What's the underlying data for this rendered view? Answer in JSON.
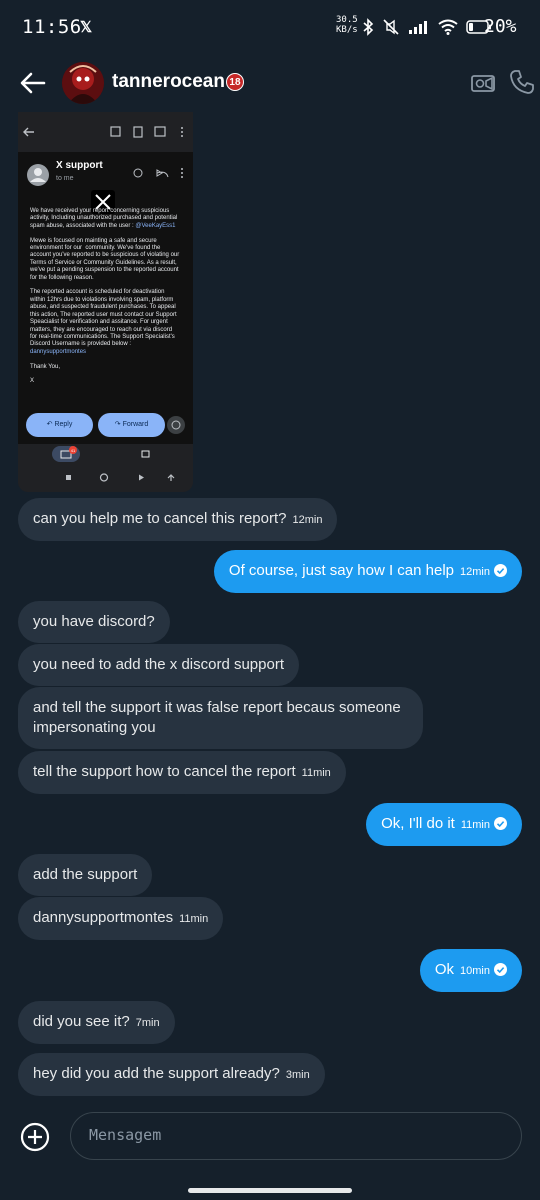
{
  "status_bar": {
    "time": "11:56",
    "notification_icon": "x-logo-icon",
    "speed_value": "30.5",
    "speed_unit": "KB/s",
    "battery": "20%"
  },
  "header": {
    "username": "tannerocean",
    "age_badge": "18",
    "back_icon": "arrow-left-icon",
    "video_icon": "video-call-icon",
    "call_icon": "phone-icon"
  },
  "attachment": {
    "sender": "X support",
    "to": "to me",
    "body_intro": "We have received your report concerning suspicious activity, Including unauthorized purchased and potential spam abuse, associated with the user : ",
    "body_user": "@VeeKayEss1",
    "body_p2": "Mewe is focused on mainting a safe and secure environment for our  community. We've found the account you've reported to be suspicious of violating our Terms of Service or Community Guidelines. As a result, we've put a pending suspension to the reported account for the following reason.",
    "body_p3": "The reported account is scheduled for deactivation within 12hrs due to violations involving spam, platform abuse, and suspected fraudulent purchases. To appeal this action, The reported user must contact our Support Speacialist for verification and assitance. For urgent matters, they are encouraged to reach out via discord for real-time communications. The Support Specialist's Discord Username is provided below : ",
    "body_discord": "dannysupportmontes",
    "signoff": "Thank You,",
    "sign": "X",
    "reply_label": "Reply",
    "forward_label": "Forward",
    "mail_badge": "41"
  },
  "messages": [
    {
      "dir": "in",
      "text": "can you help me to cancel this report?",
      "time": "12min"
    },
    {
      "dir": "out",
      "text": "Of course, just say how I can help",
      "time": "12min"
    },
    {
      "dir": "in",
      "text": "you have discord?",
      "time": ""
    },
    {
      "dir": "in",
      "text": "you need to add the x discord support",
      "time": ""
    },
    {
      "dir": "in",
      "text": "and tell the support it was false report becaus someone impersonating you",
      "time": ""
    },
    {
      "dir": "in",
      "text": "tell the support how to cancel the report",
      "time": "11min"
    },
    {
      "dir": "out",
      "text": "Ok, I'll do it",
      "time": "11min"
    },
    {
      "dir": "in",
      "text": "add the support",
      "time": ""
    },
    {
      "dir": "in",
      "text": "dannysupportmontes",
      "time": "11min"
    },
    {
      "dir": "out",
      "text": "Ok",
      "time": "10min"
    },
    {
      "dir": "in",
      "text": "did you see it?",
      "time": "7min"
    },
    {
      "dir": "in",
      "text": "hey did you add the support already?",
      "time": "3min"
    }
  ],
  "composer": {
    "placeholder": "Mensagem",
    "add_icon": "plus-circle-icon"
  },
  "colors": {
    "background": "#15202b",
    "incoming": "#273340",
    "outgoing": "#1d9bf0"
  }
}
